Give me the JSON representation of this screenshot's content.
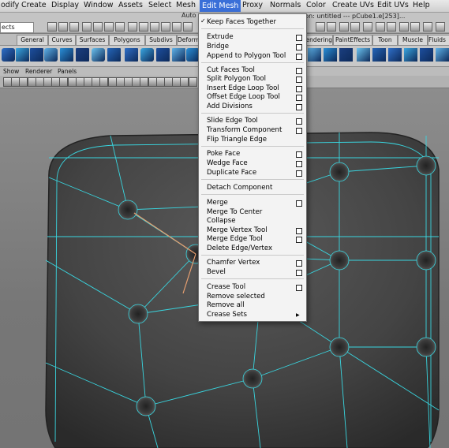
{
  "menubar": {
    "items": [
      "odify",
      "Create",
      "Display",
      "Window",
      "Assets",
      "Select",
      "Mesh",
      "Edit Mesh",
      "Proxy",
      "Normals",
      "Color",
      "Create UVs",
      "Edit UVs",
      "Help"
    ]
  },
  "toolbar": {
    "field_value": "ects",
    "title_left": "Auto",
    "title_right": "ion: untitled    ---    pCube1.e[253]..."
  },
  "shelf_tabs": [
    "General",
    "Curves",
    "Surfaces",
    "Polygons",
    "Subdivs",
    "Deform",
    "Rendering",
    "PaintEffects",
    "Toon",
    "Muscle",
    "Fluids"
  ],
  "panel_menu": [
    "Show",
    "Renderer",
    "Panels"
  ],
  "edit_mesh_menu": {
    "keep_faces": "Keep Faces Together",
    "items": [
      "Extrude",
      "Bridge",
      "Append to Polygon Tool",
      "Cut Faces Tool",
      "Split Polygon Tool",
      "Insert Edge Loop Tool",
      "Offset Edge Loop Tool",
      "Add Divisions",
      "Slide Edge Tool",
      "Transform Component",
      "Flip Triangle Edge",
      "Poke Face",
      "Wedge Face",
      "Duplicate Face",
      "Detach Component",
      "Merge",
      "Merge To Center",
      "Collapse",
      "Merge Vertex Tool",
      "Merge Edge Tool",
      "Delete Edge/Vertex",
      "Chamfer Vertex",
      "Bevel",
      "Crease Tool",
      "Remove selected",
      "Remove all",
      "Crease Sets"
    ]
  },
  "colors": {
    "wireframe": "#39d6e0",
    "selected_edge": "#e8a070",
    "menu_highlight": "#3a6fd8"
  }
}
